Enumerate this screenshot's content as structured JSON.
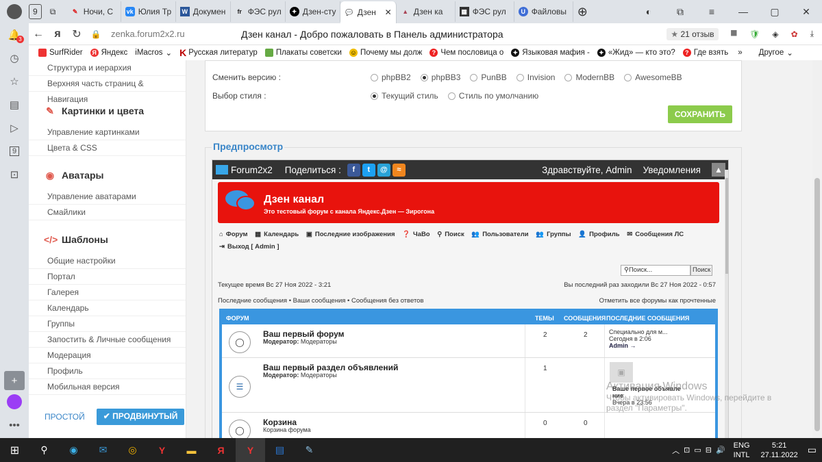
{
  "browser": {
    "tabs": [
      {
        "label": "9",
        "icon": "tab-counter-icon"
      },
      {
        "label": "Ночи, С",
        "icon": "page-icon"
      },
      {
        "label": "Юлия Тр",
        "icon": "vk-icon"
      },
      {
        "label": "Докумен",
        "icon": "word-icon"
      },
      {
        "label": "ФЭС рул",
        "icon": "fr-icon"
      },
      {
        "label": "Дзен-сту",
        "icon": "dzen-icon"
      },
      {
        "label": "Дзен ",
        "icon": "chat-icon",
        "active": true
      },
      {
        "label": "Дзен ка",
        "icon": "cake-icon"
      },
      {
        "label": "ФЭС рул",
        "icon": "film-icon"
      },
      {
        "label": "Файловы",
        "icon": "u-icon"
      }
    ],
    "url": "zenka.forum2x2.ru",
    "page_title": "Дзен канал - Добро пожаловать в Панель администратора",
    "reviews": "21 отзыв",
    "bookmarks": [
      "SurfRider",
      "Яндекс",
      "iMacros",
      "Русская литератур",
      "Плакаты советски",
      "Почему мы долж",
      "Чем пословица о",
      "Языковая мафия -",
      "«Жид» — кто это?",
      "Где взять"
    ],
    "bookmarks_more": "»",
    "bookmarks_other": "Другое",
    "badge_count": "3",
    "side_counter": "9"
  },
  "admin_sidebar": {
    "top_items": [
      "Структура и иерархия",
      "Верхняя часть страниц & Навигация"
    ],
    "sections": [
      {
        "title": "Картинки и цвета",
        "items": [
          "Управление картинками",
          "Цвета & CSS"
        ]
      },
      {
        "title": "Аватары",
        "items": [
          "Управление аватарами",
          "Смайлики"
        ]
      },
      {
        "title": "Шаблоны",
        "items": [
          "Общие настройки",
          "Портал",
          "Галерея",
          "Календарь",
          "Группы",
          "Запостить & Личные сообщения",
          "Модерация",
          "Профиль",
          "Мобильная версия"
        ]
      }
    ],
    "mode_simple": "ПРОСТОЙ",
    "mode_advanced": "ПРОДВИНУТЫЙ"
  },
  "settings": {
    "version_label": "Сменить версию :",
    "versions": [
      "phpBB2",
      "phpBB3",
      "PunBB",
      "Invision",
      "ModernBB",
      "AwesomeBB"
    ],
    "version_selected": "phpBB3",
    "style_label": "Выбор стиля :",
    "styles": [
      "Текущий стиль",
      "Стиль по умолчанию"
    ],
    "style_selected": "Текущий стиль",
    "save": "СОХРАНИТЬ"
  },
  "preview": {
    "title": "Предпросмотр",
    "topbar": {
      "brand": "Forum2x2",
      "share": "Поделиться :",
      "hello": "Здравствуйте, Admin",
      "notifications": "Уведомления"
    },
    "banner": {
      "title": "Дзен канал",
      "subtitle": "Это тестовый форум с канала Яндекс.Дзен — Зирогона"
    },
    "nav": [
      "Форум",
      "Календарь",
      "Последние изображения",
      "ЧаВо",
      "Поиск",
      "Пользователи",
      "Группы",
      "Профиль",
      "Сообщения ЛС",
      "Выход [ Admin ]"
    ],
    "search_placeholder": "Поиск...",
    "search_button": "Поиск",
    "current_time": "Текущее время Вс 27 Ноя 2022 - 3:21",
    "last_visit": "Вы последний раз заходили Вс 27 Ноя 2022 - 0:57",
    "links": "Последние сообщения • Ваши сообщения • Сообщения без ответов",
    "mark_read": "Отметить все форумы как прочтенные",
    "table_headers": {
      "forum": "ФОРУМ",
      "topics": "ТЕМЫ",
      "posts": "СООБЩЕНИЯ",
      "last": "ПОСЛЕДНИЕ СООБЩЕНИЯ"
    },
    "forums": [
      {
        "name": "Ваш первый форум",
        "mod_label": "Модератор:",
        "mod": "Модераторы",
        "topics": "2",
        "posts": "2",
        "last1": "Специально для м...",
        "last2": "Сегодня в 2:06",
        "last3": "Admin →"
      },
      {
        "name": "Ваш первый раздел объявлений",
        "mod_label": "Модератор:",
        "mod": "Модераторы",
        "topics": "1",
        "posts": "",
        "last1": "Ваше первое объявле",
        "last2": "ние",
        "last3": "Вчера в 23:56"
      },
      {
        "name": "Корзина",
        "mod_label": "",
        "mod": "Корзина форума",
        "topics": "0",
        "posts": "0",
        "last1": "",
        "last2": "",
        "last3": ""
      }
    ]
  },
  "windows_activation": {
    "line1": "Активация Windows",
    "line2": "Чтобы активировать Windows, перейдите в",
    "line3": "раздел \"Параметры\"."
  },
  "taskbar": {
    "lang1": "ENG",
    "lang2": "INTL",
    "time": "5:21",
    "date": "27.11.2022"
  }
}
